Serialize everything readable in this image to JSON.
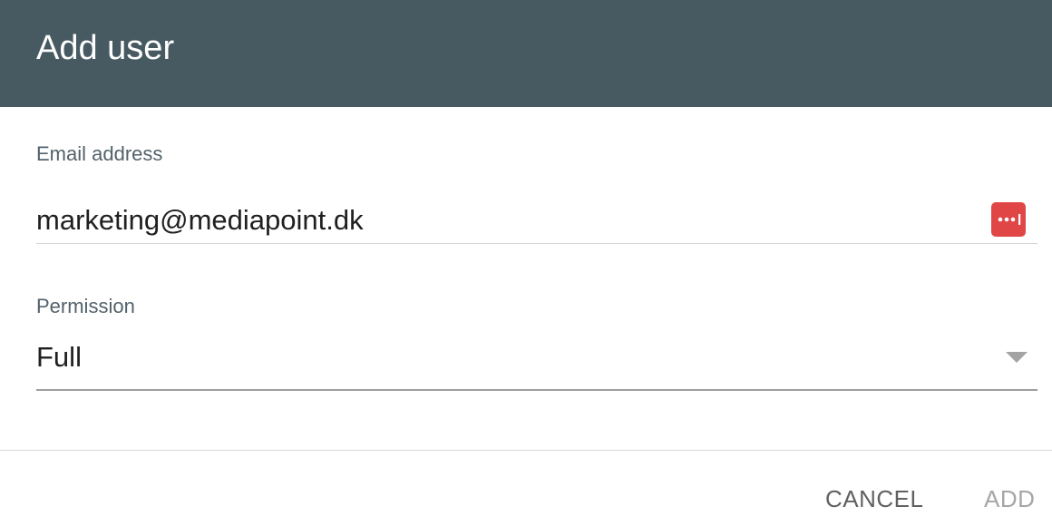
{
  "dialog": {
    "title": "Add user"
  },
  "email": {
    "label": "Email address",
    "value": "marketing@mediapoint.dk",
    "password_manager_icon": "password-manager-icon",
    "password_manager_color": "#e04646"
  },
  "permission": {
    "label": "Permission",
    "selected": "Full",
    "dropdown_icon": "chevron-down-icon"
  },
  "actions": {
    "cancel_label": "CANCEL",
    "add_label": "ADD"
  },
  "colors": {
    "header_background": "#475a62",
    "label_text": "#52626b",
    "disabled_text": "#a6a6a6"
  }
}
